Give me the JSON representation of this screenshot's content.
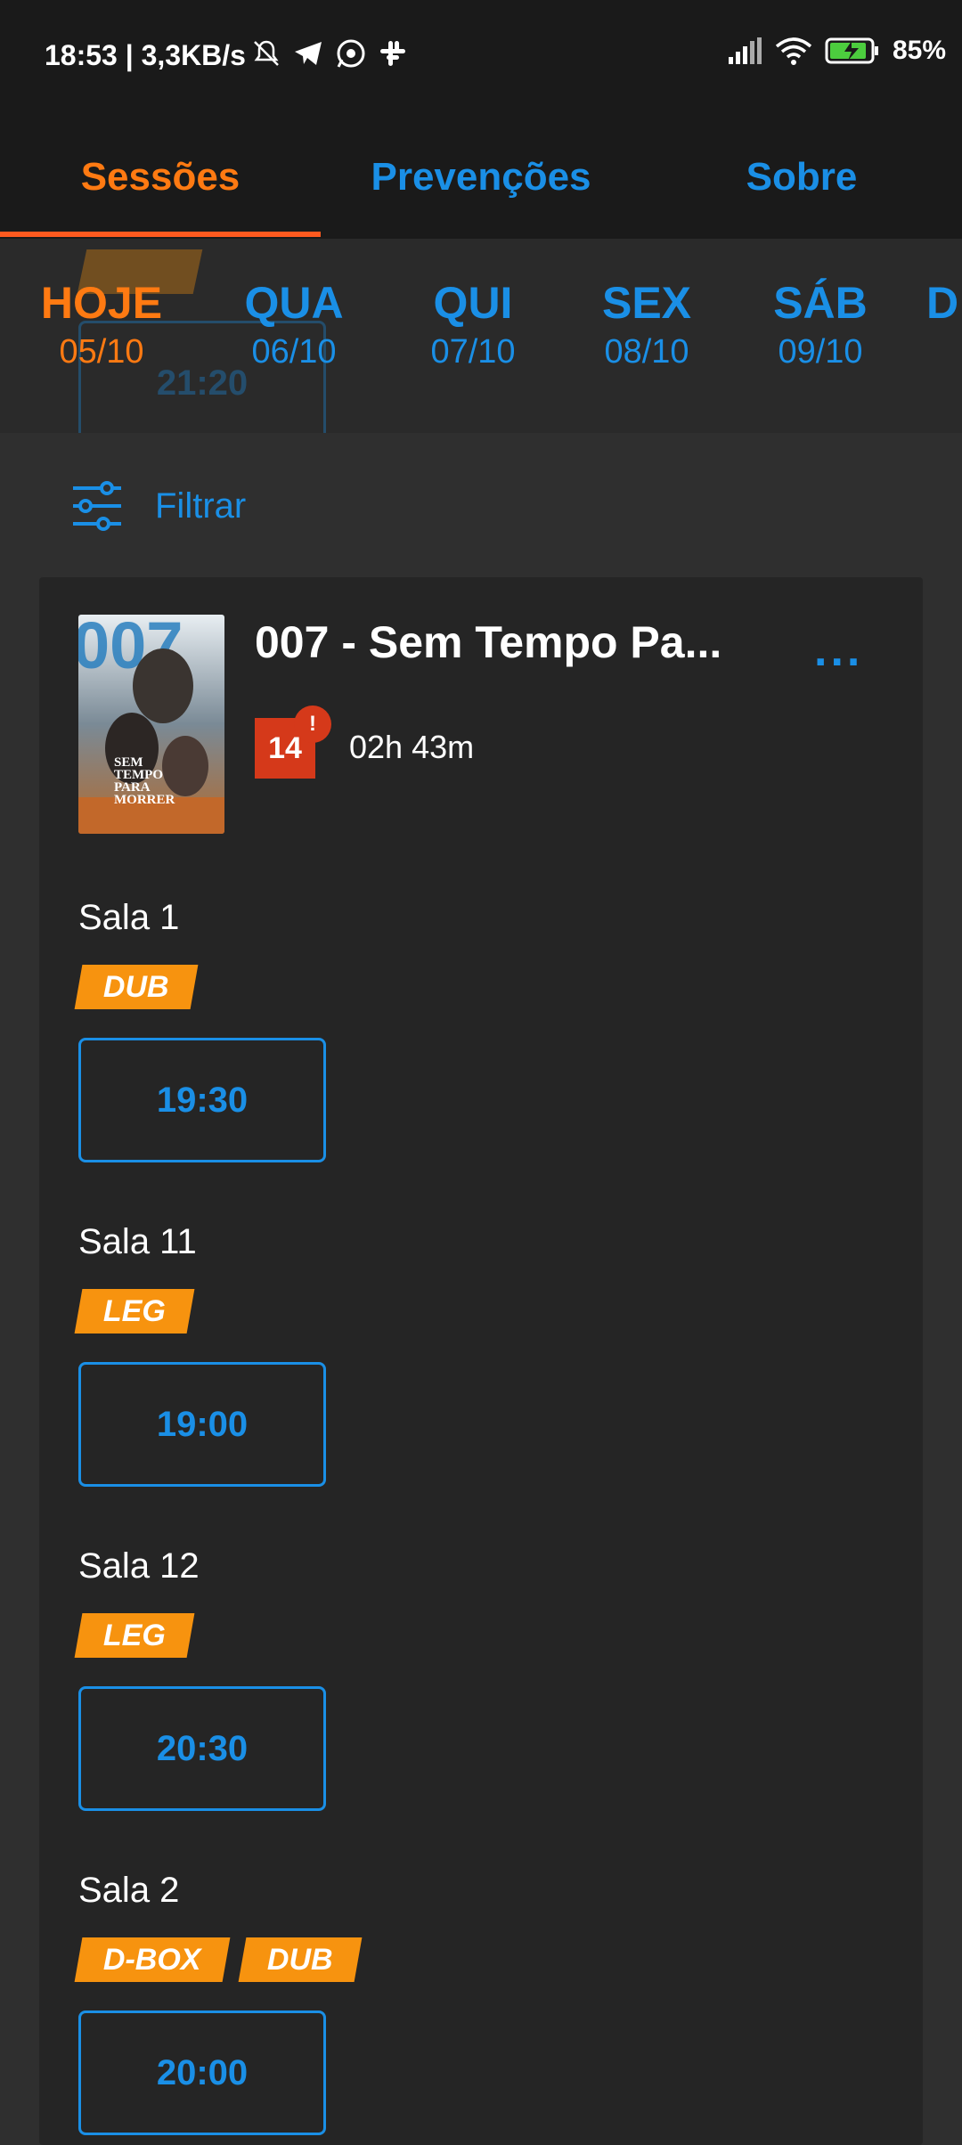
{
  "status_bar": {
    "time": "18:53 | 3,3KB/s",
    "battery": "85%"
  },
  "tabs": [
    {
      "label": "Sessões",
      "active": true
    },
    {
      "label": "Prevenções",
      "active": false
    },
    {
      "label": "Sobre",
      "active": false
    }
  ],
  "days": [
    {
      "name": "HOJE",
      "date": "05/10",
      "active": true
    },
    {
      "name": "QUA",
      "date": "06/10"
    },
    {
      "name": "QUI",
      "date": "07/10"
    },
    {
      "name": "SEX",
      "date": "08/10"
    },
    {
      "name": "SÁB",
      "date": "09/10"
    },
    {
      "name": "D",
      "date": ""
    }
  ],
  "ghost": {
    "tag": "LEG",
    "time": "21:20"
  },
  "filter": {
    "label": "Filtrar",
    "icon": "sliders-icon"
  },
  "movie": {
    "title": "007 - Sem Tempo Pa...",
    "rating": "14",
    "rating_alert": "!",
    "duration": "02h 43m",
    "more": "..."
  },
  "salas": [
    {
      "name": "Sala 1",
      "tags": [
        "DUB"
      ],
      "time": "19:30"
    },
    {
      "name": "Sala 11",
      "tags": [
        "LEG"
      ],
      "time": "19:00"
    },
    {
      "name": "Sala 12",
      "tags": [
        "LEG"
      ],
      "time": "20:30"
    },
    {
      "name": "Sala 2",
      "tags": [
        "D-BOX",
        "DUB"
      ],
      "time": "20:00"
    }
  ],
  "colors": {
    "accent_orange": "#ff7a12",
    "accent_blue": "#1a8fe6",
    "tag": "#f7930f",
    "rating": "#d5391a"
  }
}
